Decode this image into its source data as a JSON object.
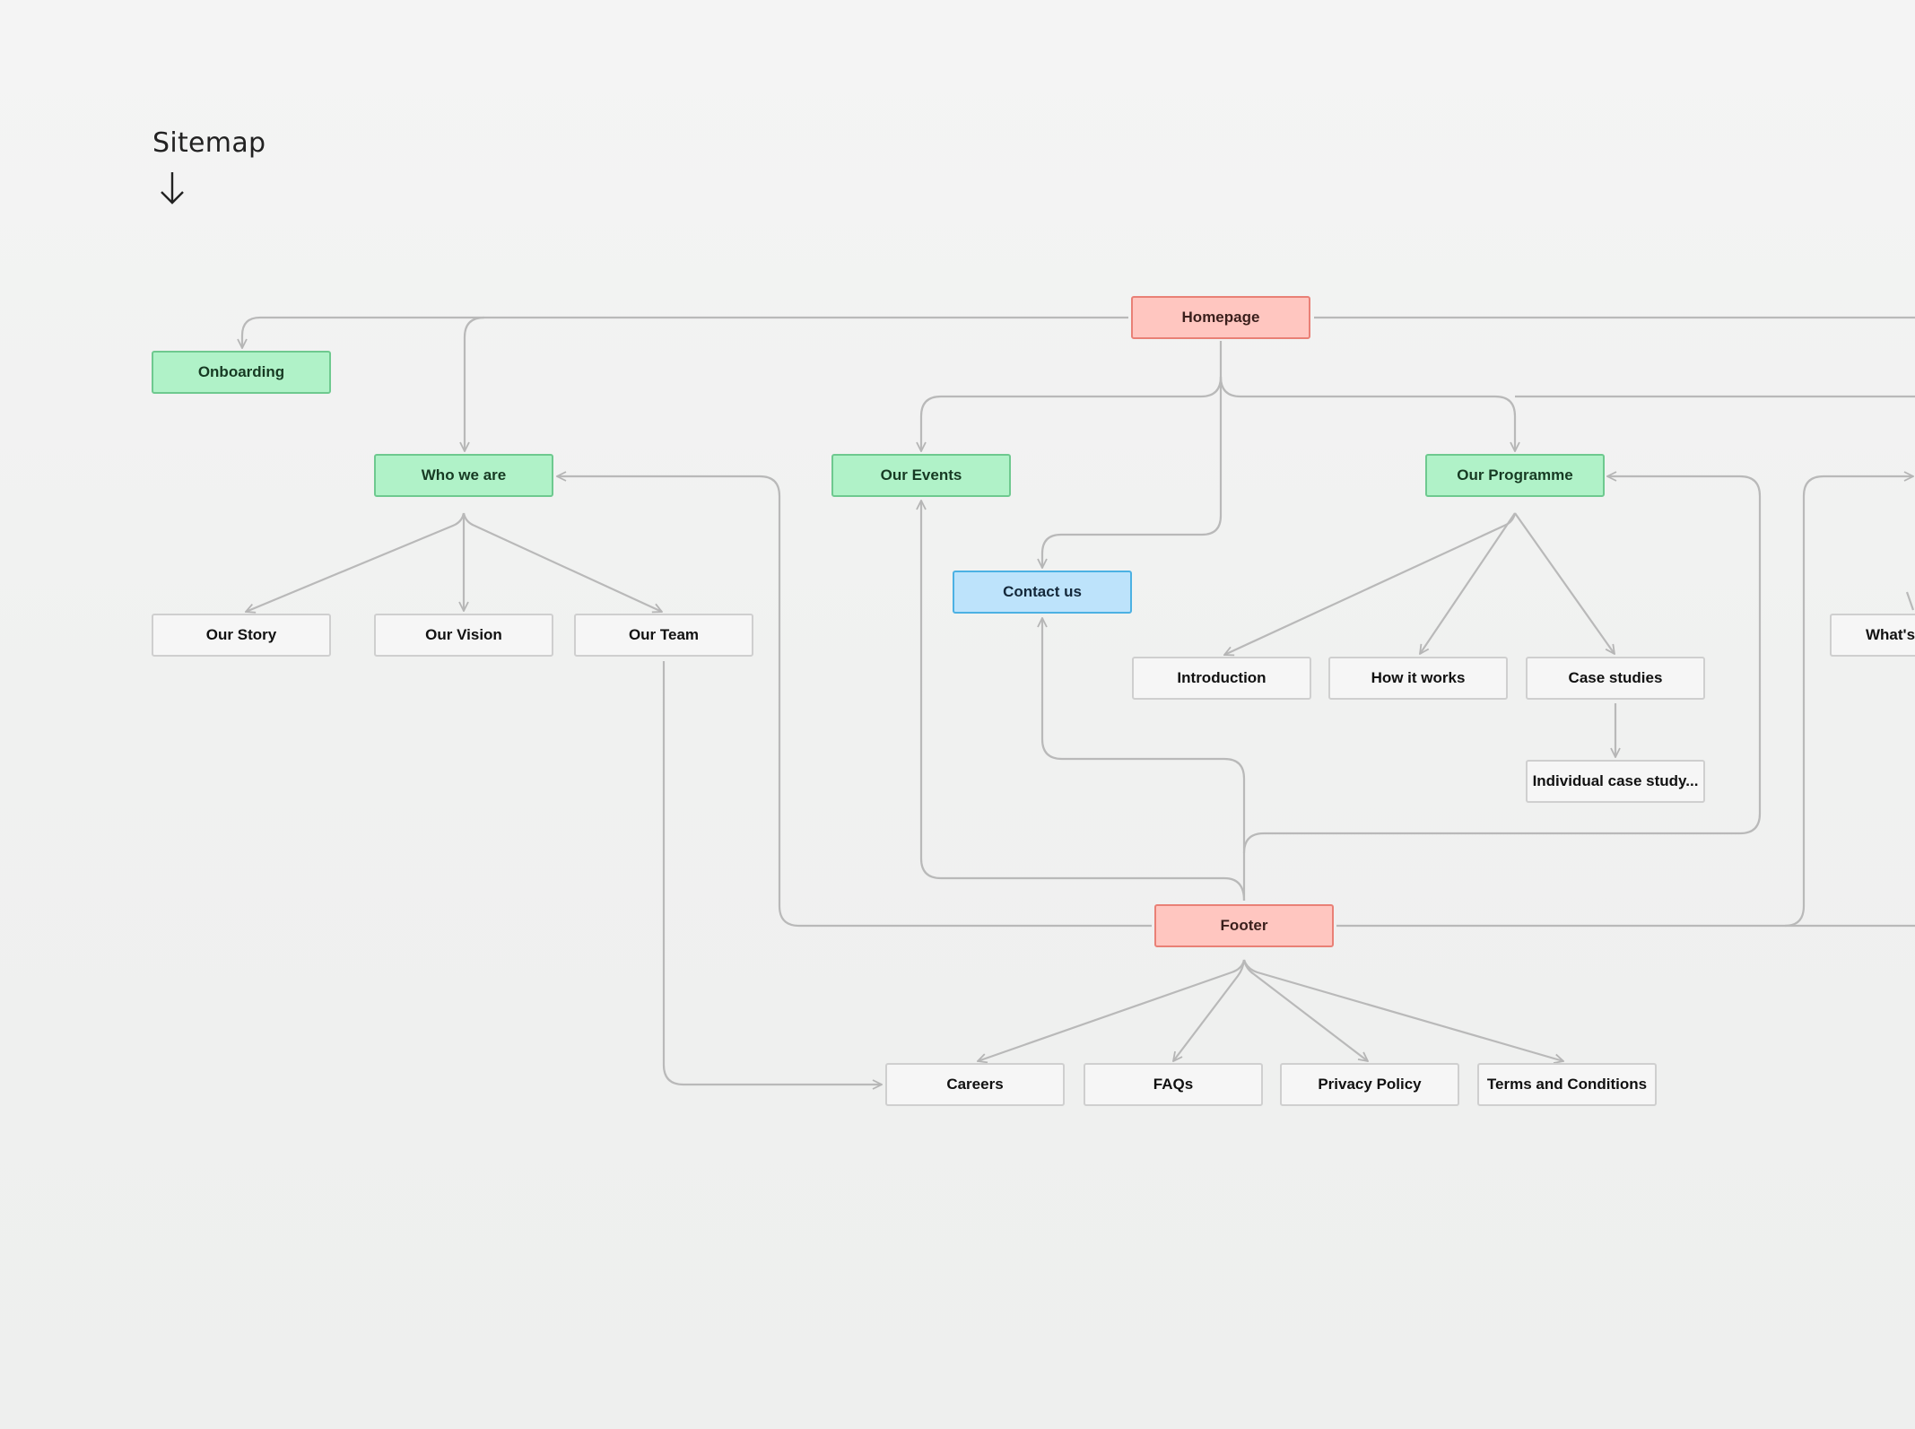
{
  "page": {
    "title": "Sitemap",
    "title_icon": "arrow-down-icon"
  },
  "colors": {
    "page_node_red": "#ffc6c0",
    "section_node_green": "#b0f2c8",
    "contact_node_blue": "#bde3fb",
    "leaf_node": "#f6f6f6",
    "connector": "#b9b9b9"
  },
  "nodes": {
    "homepage": "Homepage",
    "onboarding": "Onboarding",
    "who_we_are": "Who we are",
    "our_events": "Our Events",
    "our_programme": "Our Programme",
    "contact_us": "Contact us",
    "our_story": "Our Story",
    "our_vision": "Our Vision",
    "our_team": "Our Team",
    "introduction": "Introduction",
    "how_it_works": "How it works",
    "case_studies": "Case studies",
    "individual_case_study": "Individual case study...",
    "whats": "What's",
    "footer": "Footer",
    "careers": "Careers",
    "faqs": "FAQs",
    "privacy_policy": "Privacy Policy",
    "terms_and_conditions": "Terms and Conditions"
  },
  "edges": [
    {
      "from": "homepage",
      "to": "onboarding"
    },
    {
      "from": "homepage",
      "to": "who_we_are"
    },
    {
      "from": "homepage",
      "to": "our_events"
    },
    {
      "from": "homepage",
      "to": "our_programme"
    },
    {
      "from": "homepage",
      "to": "contact_us"
    },
    {
      "from": "who_we_are",
      "to": "our_story"
    },
    {
      "from": "who_we_are",
      "to": "our_vision"
    },
    {
      "from": "who_we_are",
      "to": "our_team"
    },
    {
      "from": "our_programme",
      "to": "introduction"
    },
    {
      "from": "our_programme",
      "to": "how_it_works"
    },
    {
      "from": "our_programme",
      "to": "case_studies"
    },
    {
      "from": "case_studies",
      "to": "individual_case_study"
    },
    {
      "from": "footer",
      "to": "who_we_are"
    },
    {
      "from": "footer",
      "to": "our_events"
    },
    {
      "from": "footer",
      "to": "contact_us"
    },
    {
      "from": "footer",
      "to": "our_programme"
    },
    {
      "from": "footer",
      "to": "careers"
    },
    {
      "from": "footer",
      "to": "faqs"
    },
    {
      "from": "footer",
      "to": "privacy_policy"
    },
    {
      "from": "footer",
      "to": "terms_and_conditions"
    },
    {
      "from": "our_team",
      "to": "careers"
    }
  ]
}
